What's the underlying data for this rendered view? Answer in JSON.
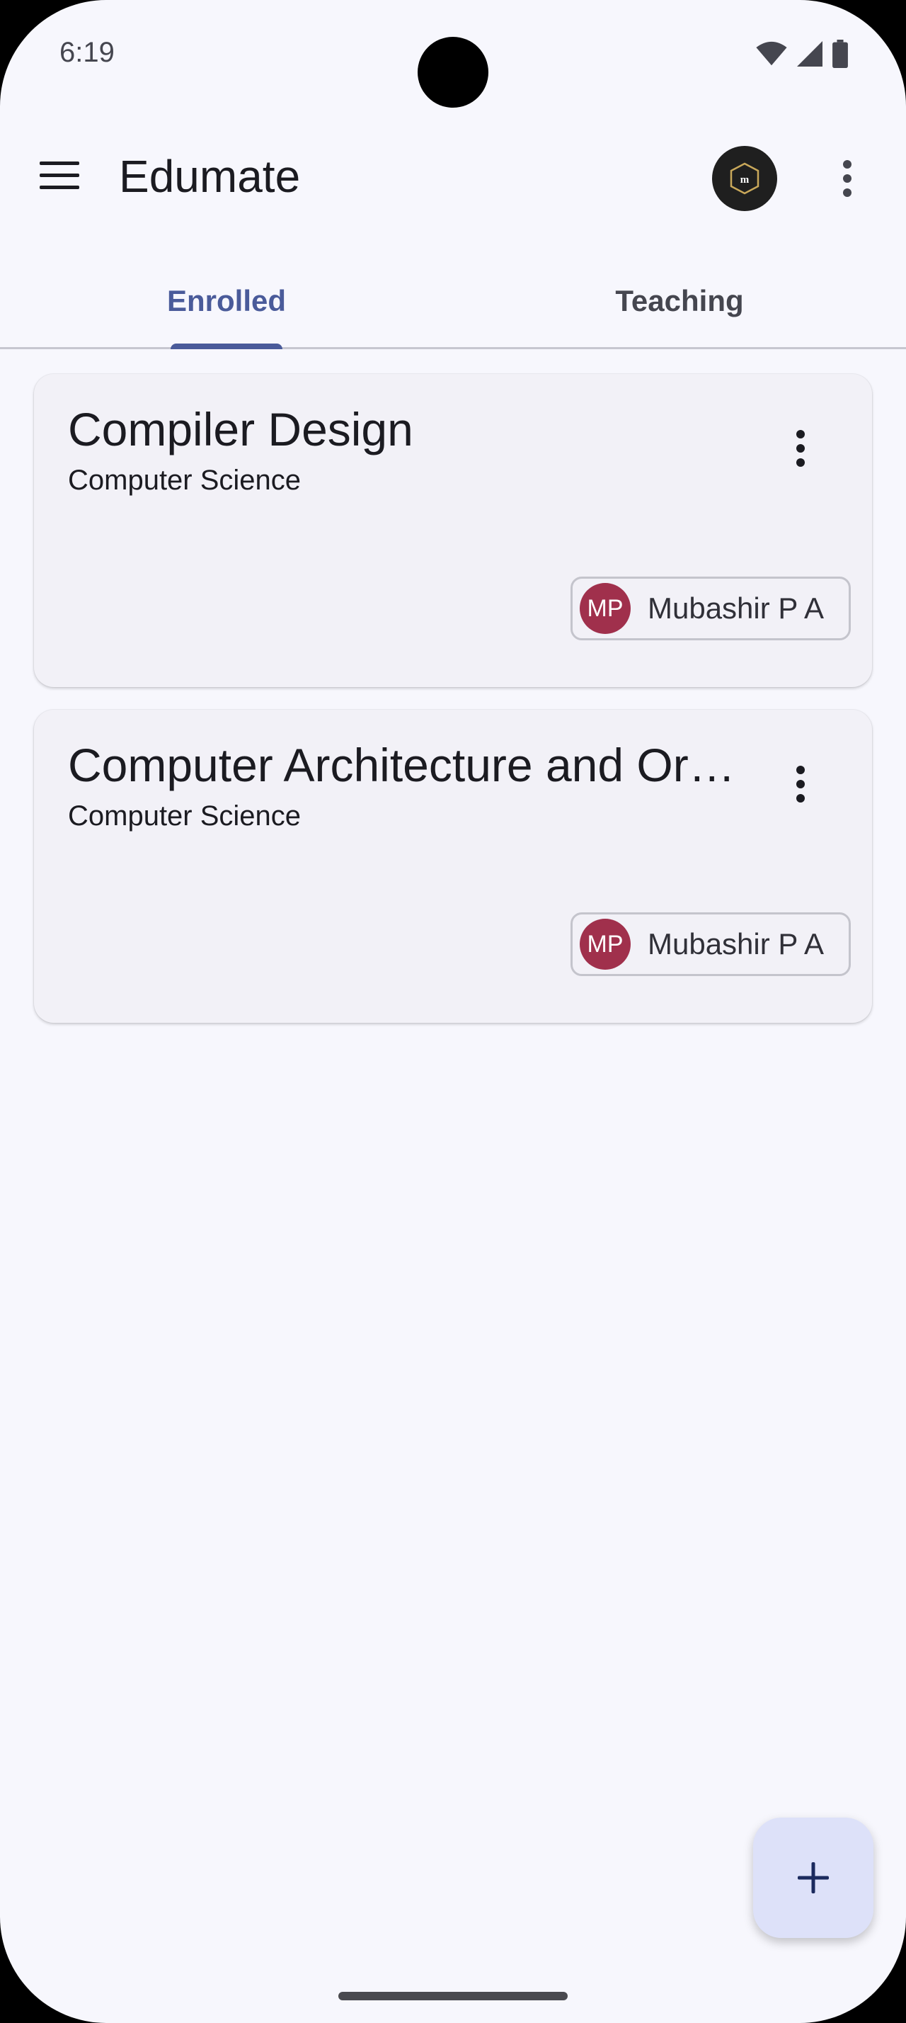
{
  "status_bar": {
    "time": "6:19"
  },
  "app_bar": {
    "title": "Edumate"
  },
  "tabs": [
    {
      "label": "Enrolled",
      "selected": true
    },
    {
      "label": "Teaching",
      "selected": false
    }
  ],
  "courses": [
    {
      "title": "Compiler Design",
      "subtitle": "Computer Science",
      "teacher_initials": "MP",
      "teacher_name": "Mubashir P A"
    },
    {
      "title": "Computer Architecture and Organization",
      "subtitle": "Computer Science",
      "teacher_initials": "MP",
      "teacher_name": "Mubashir P A"
    }
  ],
  "colors": {
    "accent": "#4a5b9a",
    "avatar": "#a0304c",
    "fab": "#dde1f9",
    "background": "#f7f7fd"
  },
  "icons": {
    "menu": "menu-icon",
    "more": "more-vert-icon",
    "add": "add-icon",
    "profile": "profile-avatar-icon"
  }
}
